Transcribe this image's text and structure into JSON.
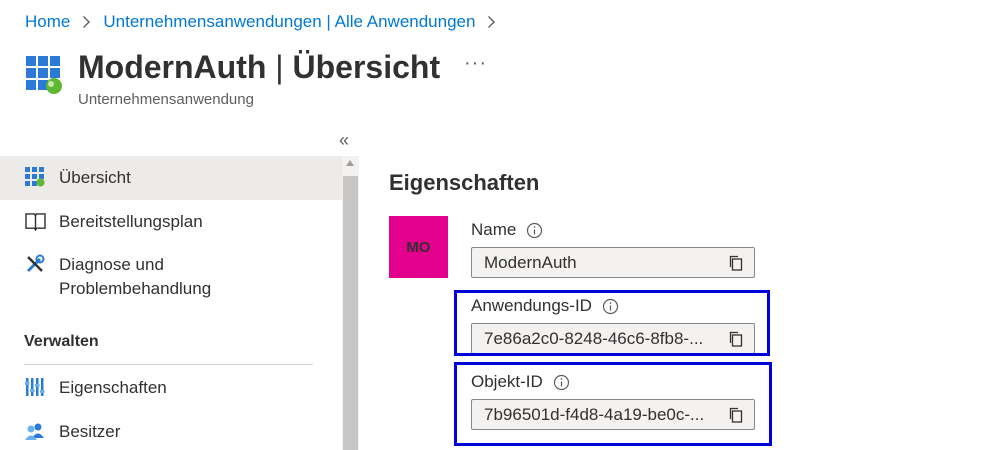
{
  "breadcrumb": {
    "items": [
      "Home",
      "Unternehmensanwendungen | Alle Anwendungen"
    ]
  },
  "header": {
    "app_name": "ModernAuth",
    "separator": " | ",
    "page": "Übersicht",
    "subtitle": "Unternehmensanwendung",
    "more": "···"
  },
  "sidebar": {
    "collapse": "«",
    "items": [
      {
        "label": "Übersicht",
        "icon": "grid-icon",
        "active": true
      },
      {
        "label": "Bereitstellungsplan",
        "icon": "book-icon",
        "active": false
      },
      {
        "label": "Diagnose und\nProblembehandlung",
        "label_line1": "Diagnose und",
        "label_line2": "Problembehandlung",
        "icon": "wrench-icon",
        "active": false
      }
    ],
    "section_header": "Verwalten",
    "manage_items": [
      {
        "label": "Eigenschaften",
        "icon": "properties-icon"
      },
      {
        "label": "Besitzer",
        "icon": "owners-icon"
      }
    ]
  },
  "content": {
    "title": "Eigenschaften",
    "avatar_initials": "MO",
    "fields": [
      {
        "label": "Name",
        "value": "ModernAuth"
      },
      {
        "label": "Anwendungs-ID",
        "value": "7e86a2c0-8248-46c6-8fb8-..."
      },
      {
        "label": "Objekt-ID",
        "value": "7b96501d-f4d8-4a19-be0c-..."
      }
    ]
  },
  "colors": {
    "link": "#0078d4",
    "avatar": "#e3008c",
    "highlight": "#0000dd",
    "active_nav": "#edebe9"
  }
}
